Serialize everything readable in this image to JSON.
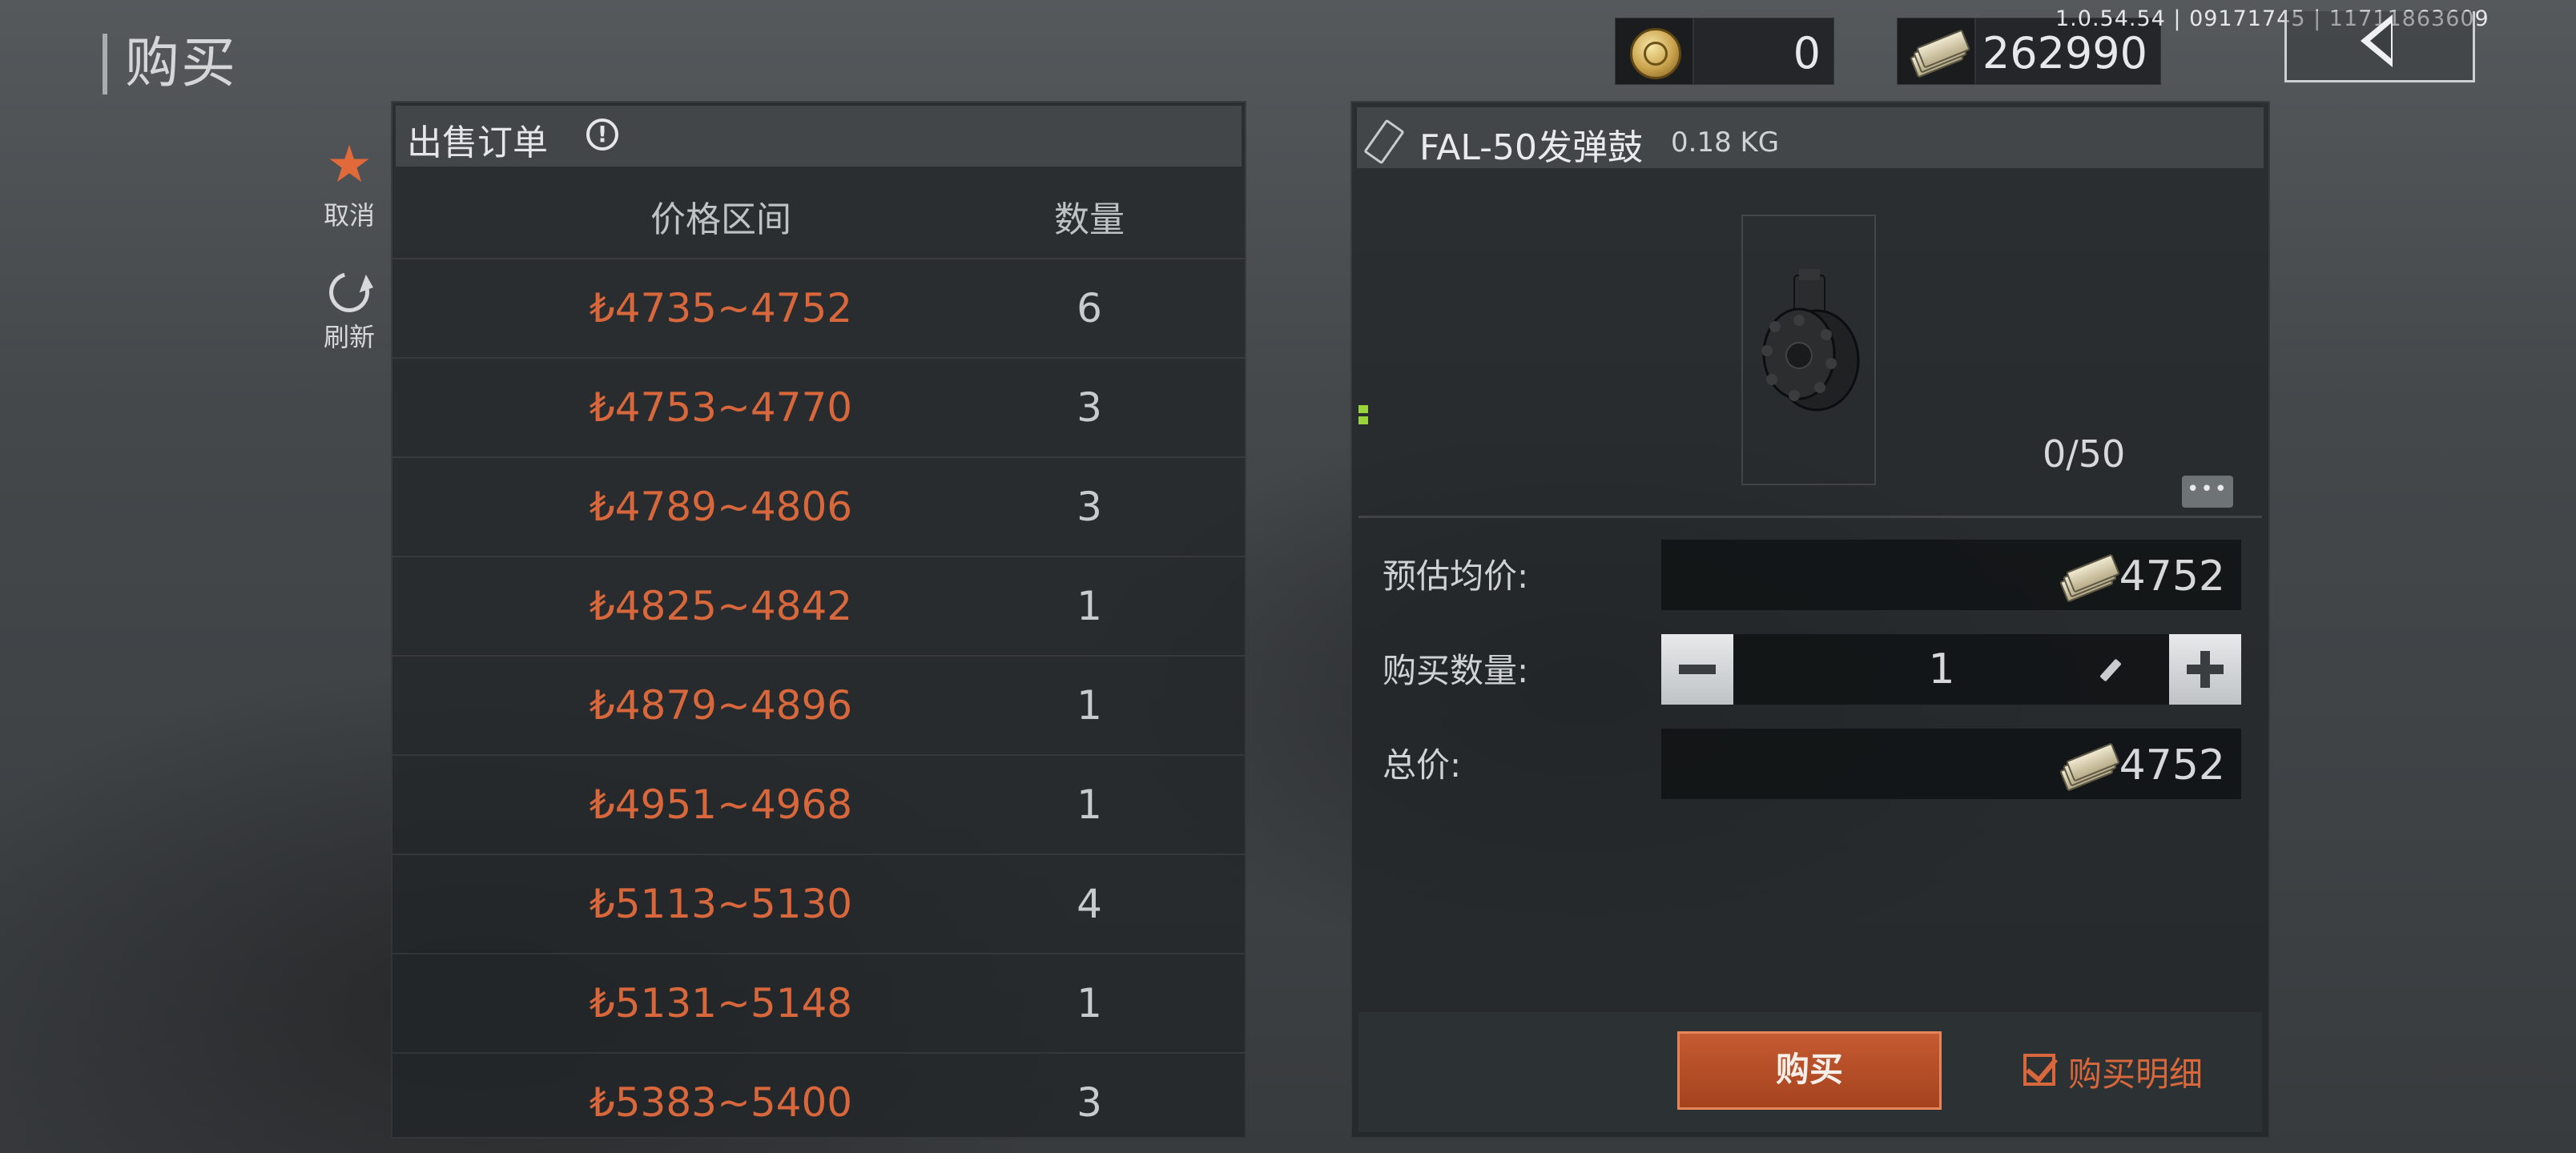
{
  "header": {
    "title": "购买",
    "build_info": "1.0.54.54 | 09171745 | 11711863609",
    "coin_balance": "0",
    "cash_balance": "262990"
  },
  "side_actions": {
    "cancel_label": "取消",
    "refresh_label": "刷新"
  },
  "orders": {
    "title": "出售订单",
    "info_glyph": "!",
    "col_price": "价格区间",
    "col_qty": "数量",
    "rows": [
      {
        "price": "₺4735~4752",
        "qty": "6"
      },
      {
        "price": "₺4753~4770",
        "qty": "3"
      },
      {
        "price": "₺4789~4806",
        "qty": "3"
      },
      {
        "price": "₺4825~4842",
        "qty": "1"
      },
      {
        "price": "₺4879~4896",
        "qty": "1"
      },
      {
        "price": "₺4951~4968",
        "qty": "1"
      },
      {
        "price": "₺5113~5130",
        "qty": "4"
      },
      {
        "price": "₺5131~5148",
        "qty": "1"
      },
      {
        "price": "₺5383~5400",
        "qty": "3"
      }
    ]
  },
  "item": {
    "name": "FAL-50发弹鼓",
    "weight": "0.18 KG",
    "stock": "0/50",
    "more_glyph": "•••"
  },
  "form": {
    "avg_label": "预估均价:",
    "avg_value": "4752",
    "qty_label": "购买数量:",
    "qty_value": "1",
    "total_label": "总价:",
    "total_value": "4752"
  },
  "footer": {
    "buy_label": "购买",
    "detail_label": "购买明细",
    "detail_checked": true
  },
  "colors": {
    "accent": "#d9673c",
    "buy_button": "#b44d27",
    "marker_green": "#9bd43a"
  }
}
